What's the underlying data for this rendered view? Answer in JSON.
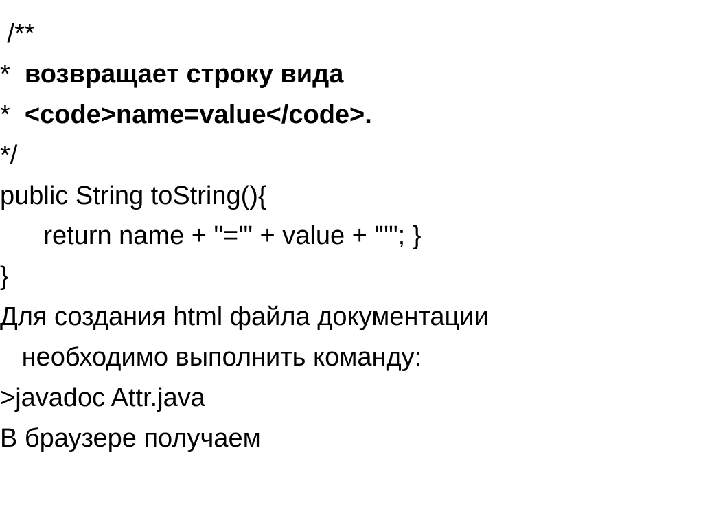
{
  "lines": {
    "l1": " /**",
    "l2a": "*  ",
    "l2b": "возвращает строку вида",
    "l3a": "*  ",
    "l3b": "<code>name=value</code>.",
    "l4": "*/",
    "l5": "public String toString(){",
    "l6": "      return name + \"='\" + value + \"'\"; }",
    "l7": "}",
    "l8": "Для создания html файла документации",
    "l9": "   необходимо выполнить команду:",
    "l10": ">javadoc Attr.java",
    "l11": "В браузере получаем"
  }
}
